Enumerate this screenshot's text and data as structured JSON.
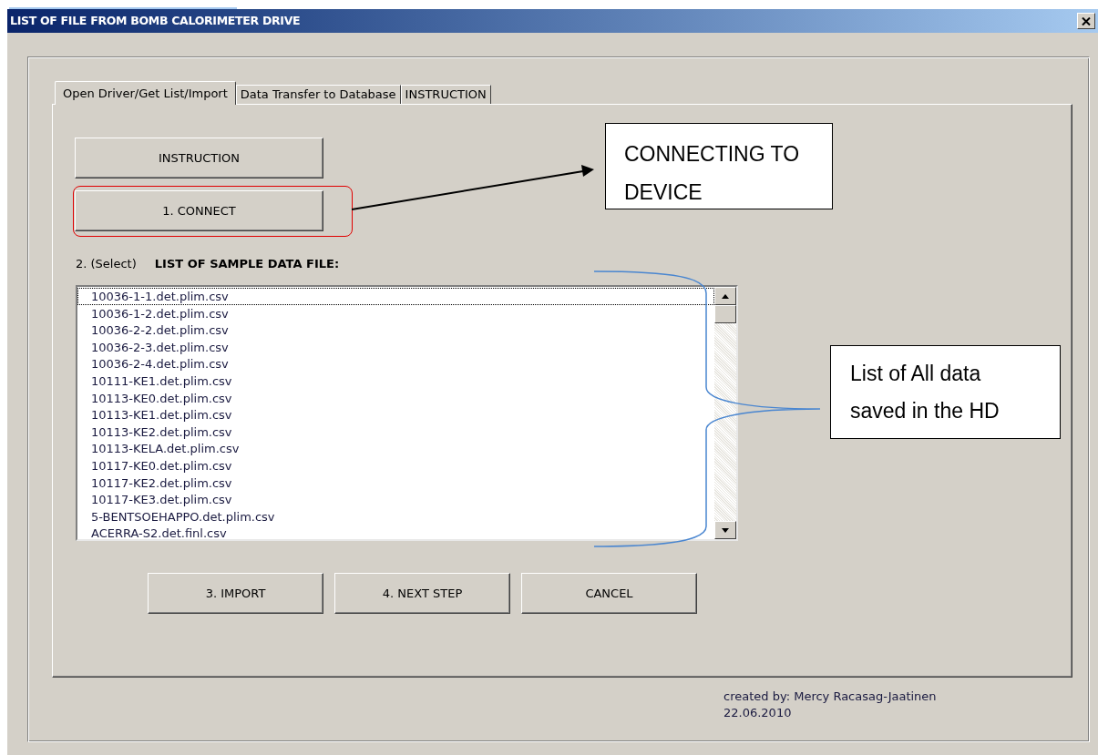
{
  "window": {
    "title": "LIST OF FILE FROM BOMB CALORIMETER DRIVE"
  },
  "tabs": [
    {
      "label": "Open Driver/Get List/Import",
      "selected": true
    },
    {
      "label": "Data Transfer to Database",
      "selected": false
    },
    {
      "label": "INSTRUCTION",
      "selected": false
    }
  ],
  "top_buttons": [
    "INSTRUCTION",
    "1. CONNECT"
  ],
  "list_label": {
    "step": "2. (Select)",
    "title": "LIST OF SAMPLE DATA FILE:"
  },
  "files": [
    {
      "name": "10036-1-1.det.plim.csv",
      "focused": true
    },
    {
      "name": "10036-1-2.det.plim.csv",
      "focused": false
    },
    {
      "name": "10036-2-2.det.plim.csv",
      "focused": false
    },
    {
      "name": "10036-2-3.det.plim.csv",
      "focused": false
    },
    {
      "name": "10036-2-4.det.plim.csv",
      "focused": false
    },
    {
      "name": "10111-KE1.det.plim.csv",
      "focused": false
    },
    {
      "name": "10113-KE0.det.plim.csv",
      "focused": false
    },
    {
      "name": "10113-KE1.det.plim.csv",
      "focused": false
    },
    {
      "name": "10113-KE2.det.plim.csv",
      "focused": false
    },
    {
      "name": "10113-KELA.det.plim.csv",
      "focused": false
    },
    {
      "name": "10117-KE0.det.plim.csv",
      "focused": false
    },
    {
      "name": "10117-KE2.det.plim.csv",
      "focused": false
    },
    {
      "name": "10117-KE3.det.plim.csv",
      "focused": false
    },
    {
      "name": "5-BENTSOEHAPPO.det.plim.csv",
      "focused": false
    },
    {
      "name": "ACERRA-S2.det.finl.csv",
      "focused": false
    }
  ],
  "bottom_buttons": [
    "3. IMPORT",
    "4. NEXT STEP",
    "CANCEL"
  ],
  "footer": {
    "credit": "created by: Mercy Racasag-Jaatinen",
    "date": "22.06.2010"
  },
  "annotations": [
    {
      "text": "CONNECTING TO DEVICE"
    },
    {
      "text": "List of All data saved in the HD"
    }
  ]
}
